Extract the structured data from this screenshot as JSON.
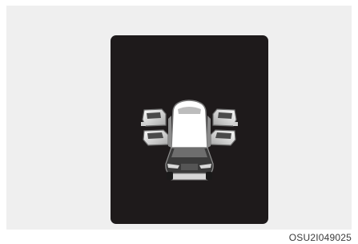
{
  "figure": {
    "caption": "OSU2I049025",
    "display": {
      "icon": "car-all-doors-open-icon",
      "doors_open": [
        "front-left",
        "rear-left",
        "front-right",
        "rear-right"
      ],
      "colors": {
        "screen_bg": "#1e1a1b",
        "figure_bg": "#efefef",
        "car_body": "#ffffff"
      }
    }
  }
}
